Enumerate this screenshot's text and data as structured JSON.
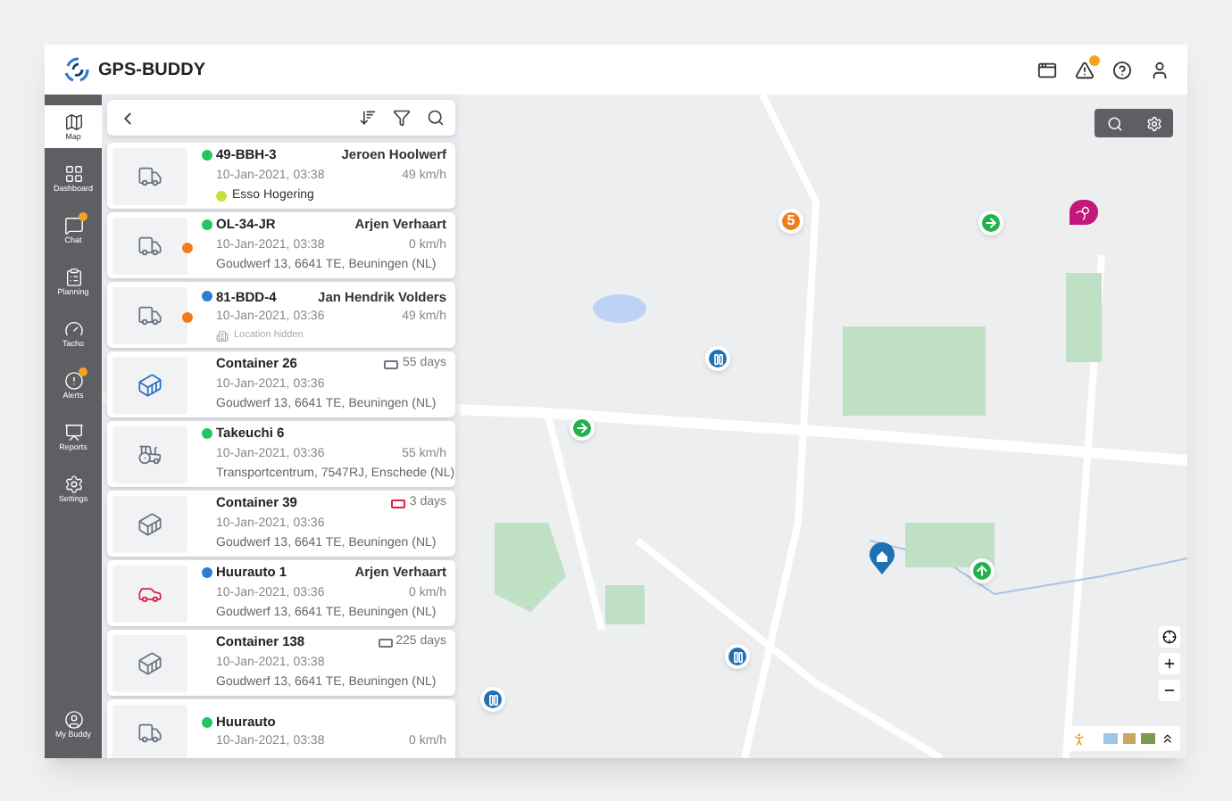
{
  "header": {
    "logo": "GPS-BUDDY",
    "notification": true
  },
  "sidebar": {
    "items": [
      {
        "label": "Map",
        "selected": true,
        "notification": false
      },
      {
        "label": "Dashboard",
        "selected": false,
        "notification": false
      },
      {
        "label": "Chat",
        "selected": false,
        "notification": true
      },
      {
        "label": "Planning",
        "selected": false,
        "notification": false
      },
      {
        "label": "Tacho",
        "selected": false,
        "notification": false
      },
      {
        "label": "Alerts",
        "selected": false,
        "notification": true
      },
      {
        "label": "Reports",
        "selected": false,
        "notification": false
      },
      {
        "label": "Settings",
        "selected": false,
        "notification": false
      }
    ],
    "footer": {
      "label": "My Buddy"
    }
  },
  "assets": [
    {
      "icon": {
        "kind": "truck",
        "color": "#6b7280"
      },
      "status": {
        "color": "#22c55e"
      },
      "badge": false,
      "title": "49-BBH-3",
      "right": "Jeroen Hoolwerf",
      "time": "10-Jan-2021, 03:38",
      "reading": "49 km/h",
      "location": {
        "kind": "place",
        "text": "Esso Hogering",
        "color": "#c6e03a"
      }
    },
    {
      "icon": {
        "kind": "truck",
        "color": "#6b7280"
      },
      "status": {
        "color": "#22c55e"
      },
      "badge": true,
      "title": "OL-34-JR",
      "right": "Arjen Verhaart",
      "time": "10-Jan-2021, 03:38",
      "reading": "0 km/h",
      "location": {
        "kind": "address",
        "text": "Goudwerf 13, 6641 TE, Beuningen (NL)"
      }
    },
    {
      "icon": {
        "kind": "truck",
        "color": "#6b7280"
      },
      "status": {
        "color": "#2b7bd0"
      },
      "badge": true,
      "title": "81-BDD-4",
      "right": "Jan Hendrik Volders",
      "time": "10-Jan-2021, 03:36",
      "reading": "49 km/h",
      "location": {
        "kind": "hidden",
        "text": "Location hidden"
      }
    },
    {
      "icon": {
        "kind": "container",
        "color": "#2b6cc4"
      },
      "badge": false,
      "title": "Container 26",
      "battery": {
        "text": "55 days",
        "color": "#6b7280"
      },
      "time": "10-Jan-2021, 03:36",
      "location": {
        "kind": "address",
        "text": "Goudwerf 13, 6641 TE, Beuningen (NL)"
      }
    },
    {
      "icon": {
        "kind": "excavator",
        "color": "#6b7280"
      },
      "status": {
        "color": "#22c55e"
      },
      "badge": false,
      "title": "Takeuchi 6",
      "time": "10-Jan-2021, 03:36",
      "reading": "55 km/h",
      "location": {
        "kind": "address",
        "text": "Transportcentrum, 7547RJ, Enschede (NL)"
      }
    },
    {
      "icon": {
        "kind": "container",
        "color": "#6b7280"
      },
      "badge": false,
      "title": "Container 39",
      "battery": {
        "text": "3 days",
        "color": "#e11d48"
      },
      "time": "10-Jan-2021, 03:36",
      "location": {
        "kind": "address",
        "text": "Goudwerf 13, 6641 TE, Beuningen (NL)"
      }
    },
    {
      "icon": {
        "kind": "car",
        "color": "#e11d48"
      },
      "status": {
        "color": "#2b7bd0"
      },
      "badge": false,
      "title": "Huurauto 1",
      "right": "Arjen Verhaart",
      "time": "10-Jan-2021, 03:36",
      "reading": "0 km/h",
      "location": {
        "kind": "address",
        "text": "Goudwerf 13, 6641 TE, Beuningen (NL)"
      }
    },
    {
      "icon": {
        "kind": "container",
        "color": "#6b7280"
      },
      "badge": false,
      "title": "Container 138",
      "battery": {
        "text": "225 days",
        "color": "#6b7280"
      },
      "time": "10-Jan-2021, 03:38",
      "location": {
        "kind": "address",
        "text": "Goudwerf 13, 6641 TE, Beuningen (NL)"
      }
    },
    {
      "icon": {
        "kind": "truck",
        "color": "#6b7280"
      },
      "status": {
        "color": "#22c55e"
      },
      "badge": false,
      "title": "Huurauto",
      "time": "10-Jan-2021, 03:38",
      "reading": "0 km/h"
    }
  ],
  "map_markers": [
    {
      "kind": "count",
      "text": "5",
      "color": "#f07c1e"
    },
    {
      "kind": "arrow",
      "color": "#22b14c"
    },
    {
      "kind": "person",
      "color": "#c2187a"
    },
    {
      "kind": "pause",
      "color": "#1f6fb5"
    },
    {
      "kind": "arrow",
      "color": "#22b14c"
    },
    {
      "kind": "home",
      "color": "#1f6fb5"
    },
    {
      "kind": "up",
      "color": "#22b14c"
    },
    {
      "kind": "pause",
      "color": "#1f6fb5"
    },
    {
      "kind": "pause",
      "color": "#1f6fb5"
    }
  ]
}
